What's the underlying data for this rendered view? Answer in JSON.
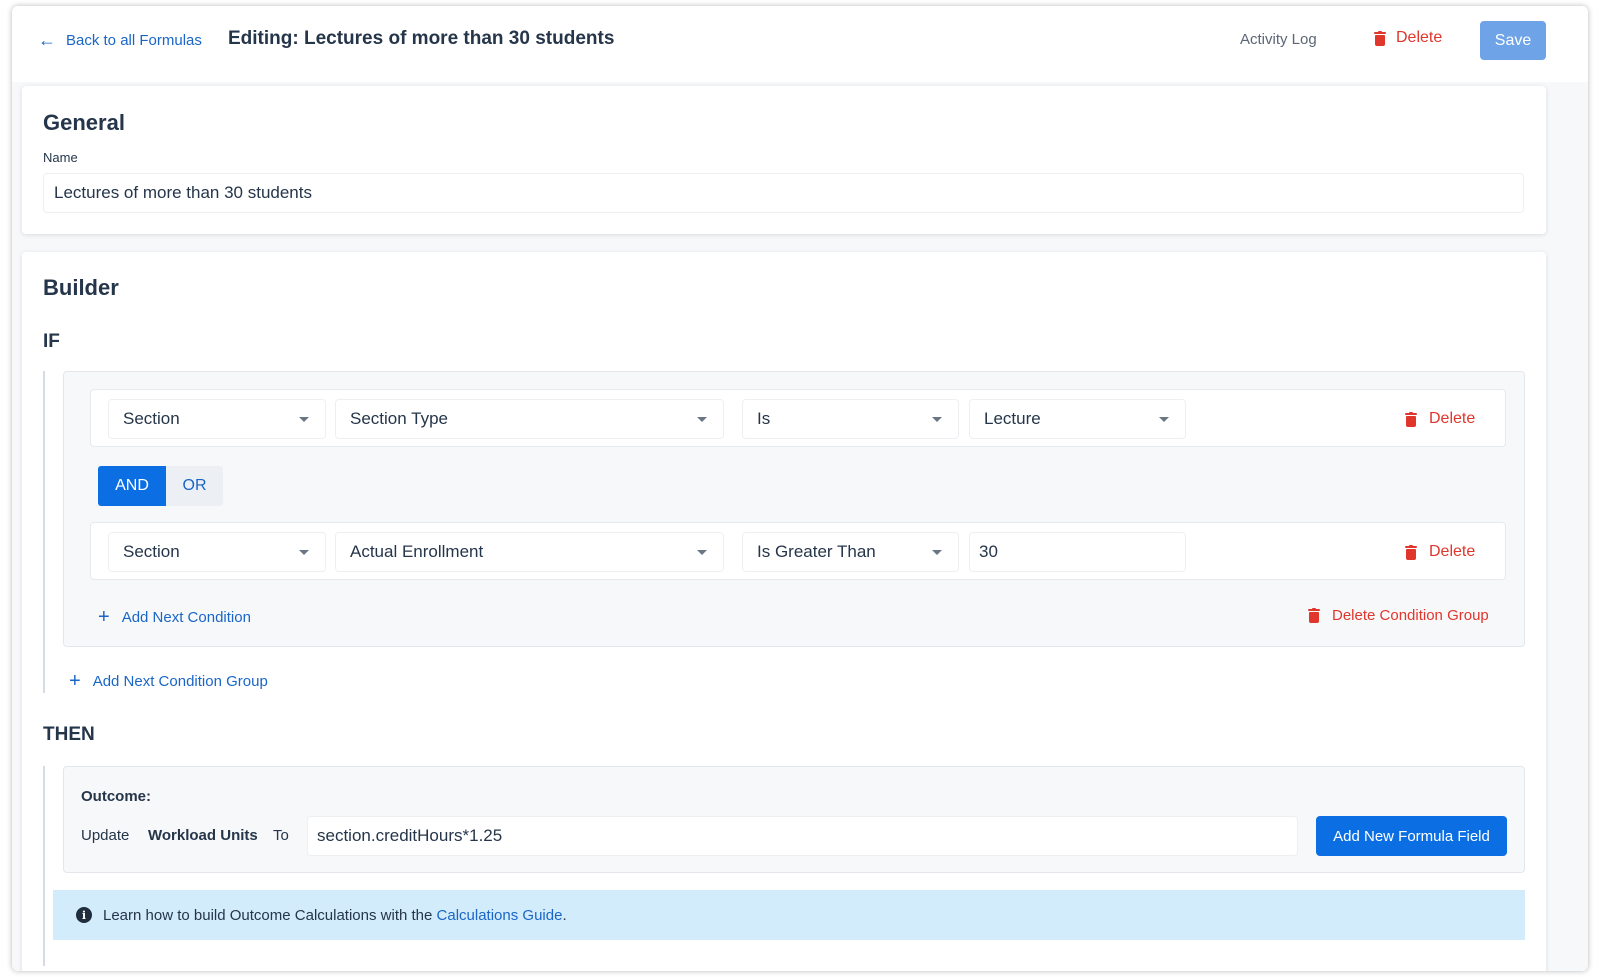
{
  "header": {
    "back_label": "Back to all Formulas",
    "title": "Editing: Lectures of more than 30 students",
    "activity_log_label": "Activity Log",
    "delete_label": "Delete",
    "save_label": "Save"
  },
  "general": {
    "heading": "General",
    "name_label": "Name",
    "name_value": "Lectures of more than 30 students"
  },
  "builder": {
    "heading": "Builder",
    "if_label": "IF",
    "conditions": [
      {
        "entity": "Section",
        "field": "Section Type",
        "operator": "Is",
        "value": "Lecture",
        "delete_label": "Delete"
      },
      {
        "entity": "Section",
        "field": "Actual Enrollment",
        "operator": "Is Greater Than",
        "value": "30",
        "delete_label": "Delete"
      }
    ],
    "logic_and": "AND",
    "logic_or": "OR",
    "add_condition_label": "Add Next Condition",
    "delete_group_label": "Delete Condition Group",
    "add_group_label": "Add Next Condition Group",
    "then_label": "THEN",
    "outcome": {
      "title": "Outcome:",
      "update_label": "Update",
      "target": "Workload Units",
      "to_label": "To",
      "formula": "section.creditHours*1.25",
      "add_formula_label": "Add New Formula Field"
    },
    "info": {
      "text": "Learn how to build Outcome Calculations with the",
      "link": "Calculations Guide",
      "suffix": "."
    }
  },
  "colors": {
    "accent": "#0b6fe3",
    "link": "#1a66c7",
    "danger": "#e0362c",
    "save_disabled": "#6ea3e8",
    "info_bg": "#d2ecfb"
  },
  "icons": {
    "back": "arrow-left-icon",
    "delete": "trash-icon",
    "add": "plus-icon",
    "dropdown": "caret-down-icon",
    "info": "info-icon"
  }
}
